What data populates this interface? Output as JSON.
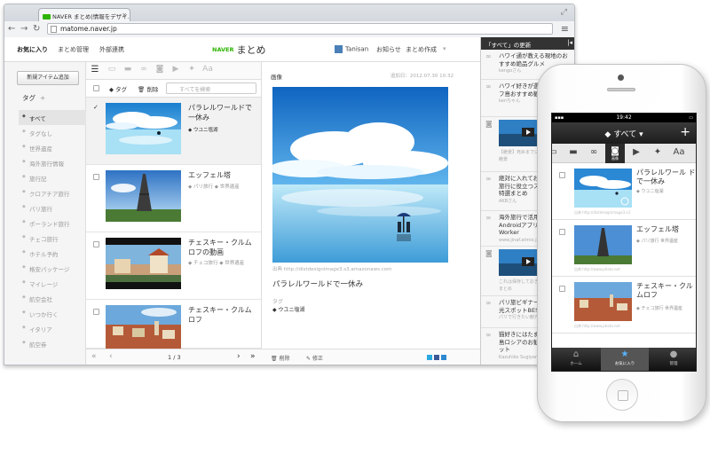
{
  "browser": {
    "tab_title": "NAVER まとめ|情報をデザイ...",
    "url": "matome.naver.jp"
  },
  "header": {
    "nav": [
      "お気に入り",
      "まとめ管理",
      "外部連携"
    ],
    "logo_naver": "NAVER",
    "logo_text": "まとめ",
    "username": "Tanisan",
    "notice": "お知らせ",
    "create": "まとめ作成"
  },
  "sidebar": {
    "new_item_button": "新規アイテム追加",
    "tag_heading": "タグ",
    "tag_add": "+",
    "tags": [
      "すべて",
      "タグなし",
      "世界遺産",
      "海外旅行情報",
      "旅行記",
      "クロアチア旅行",
      "パリ旅行",
      "ポーランド旅行",
      "チェコ旅行",
      "ホテル予約",
      "格安パッケージ",
      "マイレージ",
      "航空会社",
      "いつか行く",
      "イタリア",
      "航空券"
    ],
    "selected_tag": "すべて"
  },
  "list": {
    "tag_button": "タグ",
    "delete_button": "削除",
    "filter_placeholder": "すべてを検索",
    "items": [
      {
        "title": "パラレルワールドで一休み",
        "tags": [
          "ウユニ塩湖"
        ]
      },
      {
        "title": "エッフェル塔",
        "tags": [
          "パリ旅行",
          "世界遺産"
        ]
      },
      {
        "title": "チェスキー・クルムロフの動画",
        "tags": [
          "チェコ旅行",
          "世界遺産"
        ]
      },
      {
        "title": "チェスキー・クルムロフ",
        "tags": []
      }
    ],
    "page": "1 / 3"
  },
  "detail": {
    "label": "画像",
    "date": "追加日：2012.07.30 10:32",
    "source": "出典 http://distdesignimage3.s3.amazonaws.com",
    "title": "パラレルワールドで一休み",
    "tag_label": "タグ",
    "tag": "ウユニ塩湖",
    "delete": "削除",
    "edit": "修正"
  },
  "rightcol": {
    "heading": "「すべて」の更新",
    "items": [
      {
        "icon": "link-icon",
        "text": "ハワイ通が教える現地のおすすめ絶品グルメ",
        "sub": "kengoさん"
      },
      {
        "icon": "link-icon",
        "text": "ハワイ好きが選ぶGWのオアフ島おすすめ観光スポット",
        "sub": "kenちゃん"
      },
      {
        "icon": "camera-icon",
        "text": "",
        "sub": "【絶景】死ぬまでに行きたい世界の絶景"
      },
      {
        "icon": "link-icon",
        "text": "絶対に入れておきたい海外旅行に役立つスマホアプリ特選まとめ",
        "sub": "AKBさん"
      },
      {
        "icon": "link-icon",
        "text": "海外旅行で活用したいAndroidアプリ｜Nomad Worker",
        "sub": "www.jinaf.atmix.jp"
      },
      {
        "icon": "camera-icon",
        "text": "",
        "sub": "これは保存しておきたい海外の絶景まとめ"
      },
      {
        "icon": "link-icon",
        "text": "パリ旅ビギナーのための観光スポットBEST",
        "sub": "パリで行きたい観光スポット"
      },
      {
        "icon": "link-icon",
        "text": "猫好きにはたまらない猫の島ロシアのお勧め観光スポット",
        "sub": "Kazuhiko Sugiyama"
      }
    ]
  },
  "phone": {
    "time": "19:42",
    "nav_title": "すべて",
    "plus": "+",
    "camera_label": "画像",
    "items": [
      {
        "title": "パラレルワール ドで一休み",
        "tags": "ウユニ塩湖",
        "source": "出典 http://distdesignimage3.s3"
      },
      {
        "title": "エッフェル塔",
        "tags": "パリ旅行 世界遺産",
        "source": "出典 http://www.photo.net"
      },
      {
        "title": "チェスキー・クル ムロフ",
        "tags": "チェコ旅行 世界遺産",
        "source": "出典 http://www.photo.net"
      }
    ],
    "tabbar": [
      {
        "label": "ホーム",
        "icon": "home-icon"
      },
      {
        "label": "お気に入り",
        "icon": "star-icon"
      },
      {
        "label": "管理",
        "icon": "user-icon"
      }
    ]
  },
  "colors": {
    "naver_green": "#2db400",
    "sky": "#2f8fd8",
    "dark": "#2b2b2b"
  }
}
